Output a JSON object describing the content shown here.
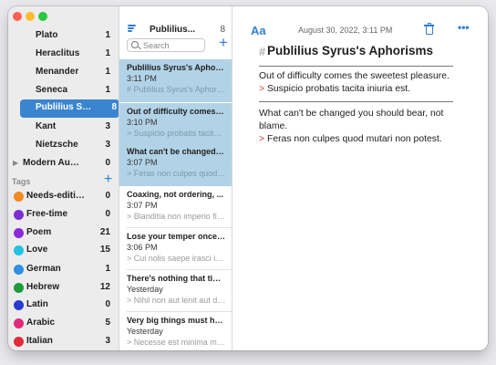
{
  "sidebar": {
    "authors": [
      {
        "label": "Plato",
        "count": "1"
      },
      {
        "label": "Heraclitus",
        "count": "1"
      },
      {
        "label": "Menander",
        "count": "1"
      },
      {
        "label": "Seneca",
        "count": "1"
      },
      {
        "label": "Publilius Syrus",
        "count": "8"
      },
      {
        "label": "Kant",
        "count": "3"
      },
      {
        "label": "Nietzsche",
        "count": "3"
      }
    ],
    "group": {
      "label": "Modern Authors",
      "count": "0"
    },
    "tags_heading": "Tags",
    "tags": [
      {
        "label": "Needs-editing",
        "count": "0",
        "color": "#f08a24"
      },
      {
        "label": "Free-time",
        "count": "0",
        "color": "#7a2fd0"
      },
      {
        "label": "Poem",
        "count": "21",
        "color": "#8a2bd6"
      },
      {
        "label": "Love",
        "count": "15",
        "color": "#22c3e0"
      },
      {
        "label": "German",
        "count": "1",
        "color": "#2f8fe0"
      },
      {
        "label": "Hebrew",
        "count": "12",
        "color": "#1e9a3c"
      },
      {
        "label": "Latin",
        "count": "0",
        "color": "#2a3bd0"
      },
      {
        "label": "Arabic",
        "count": "5",
        "color": "#e0297a"
      },
      {
        "label": "Italian",
        "count": "3",
        "color": "#e02b3b"
      }
    ]
  },
  "notelist": {
    "title": "Publilius...",
    "count": "8",
    "search_placeholder": "Search",
    "notes": [
      {
        "title": "Publilius Syrus's Aphorisms",
        "time": "3:11 PM",
        "preview": "# Publilius Syrus's Aphorisms"
      },
      {
        "title": "Out of difficulty comes the sweetest pleasure.",
        "time": "3:10 PM",
        "preview": "> Suspicio probatis tacita iniuria est."
      },
      {
        "title": "What can't be changed you should bear, not blame.",
        "time": "3:07 PM",
        "preview": "> Feras non culpes quod mutari non potest."
      },
      {
        "title": "Coaxing, not ordering, ...",
        "time": "3:07 PM",
        "preview": "> Blanditia non imperio fit dulcis Venus."
      },
      {
        "title": "Lose your temper once ...",
        "time": "3:06 PM",
        "preview": "> Cui nolis saepe irasci irascaris semel."
      },
      {
        "title": "There's nothing that time ...",
        "time": "Yesterday",
        "preview": "> Nihil non aut lenit aut domat diuturnitas."
      },
      {
        "title": "Very big things must have ...",
        "time": "Yesterday",
        "preview": "> Necesse est minima maximorum esse initia."
      }
    ]
  },
  "editor": {
    "font_button": "Aa",
    "date": "August 30, 2022, 3:11 PM",
    "more": "•••",
    "hash": "#",
    "title": "Publilius Syrus's Aphorisms",
    "blocks": [
      {
        "text": "Out of difficulty comes the sweetest pleasure.",
        "quote_mark": ">",
        "quote": "Suspicio probatis tacita iniuria est."
      },
      {
        "text": "What can't be changed you should bear, not blame.",
        "quote_mark": ">",
        "quote": "Feras non culpes quod mutari non potest."
      }
    ]
  },
  "colors": {
    "accent": "#2f7fd4",
    "selection": "#3a85d0",
    "note_selection": "#b2d3e7",
    "quote": "#d7332e"
  }
}
